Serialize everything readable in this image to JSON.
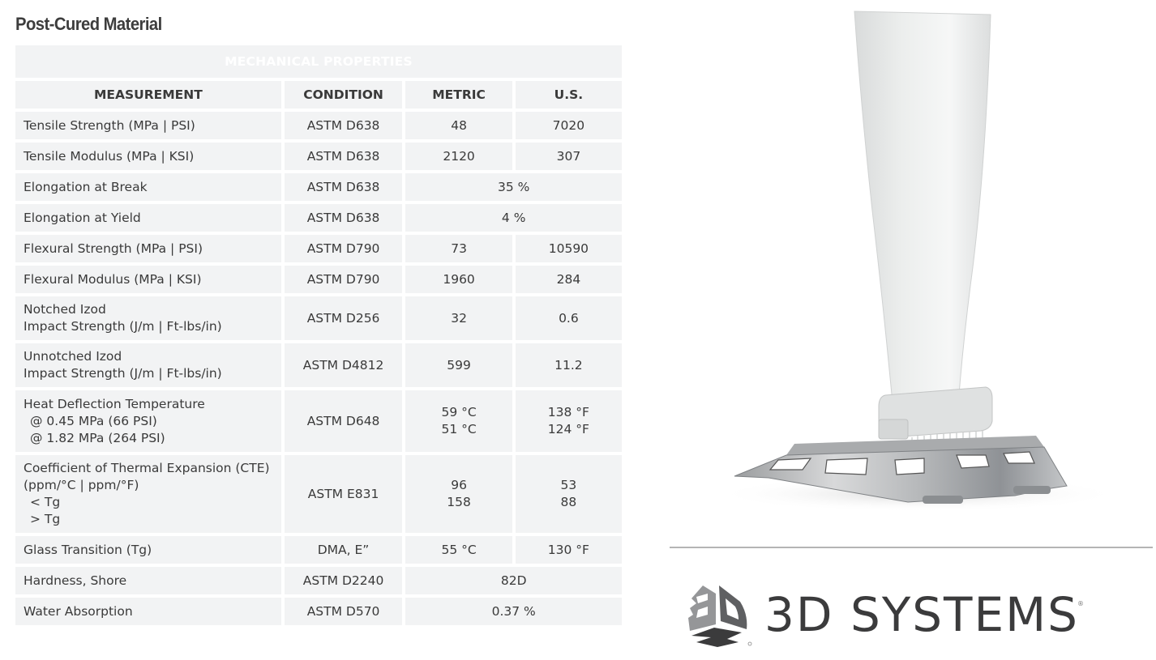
{
  "page": {
    "title": "Post-Cured Material"
  },
  "table": {
    "banner": "MECHANICAL PROPERTIES",
    "headers": {
      "measurement": "MEASUREMENT",
      "condition": "CONDITION",
      "metric": "METRIC",
      "us": "U.S."
    },
    "rows": [
      {
        "measurement": "Tensile Strength (MPa | PSI)",
        "condition": "ASTM D638",
        "metric": "48",
        "us": "7020"
      },
      {
        "measurement": "Tensile Modulus (MPa | KSI)",
        "condition": "ASTM D638",
        "metric": "2120",
        "us": "307"
      },
      {
        "measurement": "Elongation at Break",
        "condition": "ASTM D638",
        "combined": "35 %"
      },
      {
        "measurement": "Elongation at Yield",
        "condition": "ASTM D638",
        "combined": "4 %"
      },
      {
        "measurement": "Flexural Strength (MPa | PSI)",
        "condition": "ASTM D790",
        "metric": "73",
        "us": "10590"
      },
      {
        "measurement": "Flexural Modulus (MPa | KSI)",
        "condition": "ASTM D790",
        "metric": "1960",
        "us": "284"
      },
      {
        "measurement_lines": [
          "Notched Izod",
          "Impact Strength (J/m | Ft-lbs/in)"
        ],
        "condition": "ASTM D256",
        "metric": "32",
        "us": "0.6"
      },
      {
        "measurement_lines": [
          "Unnotched Izod",
          "Impact Strength (J/m | Ft-lbs/in)"
        ],
        "condition": "ASTM D4812",
        "metric": "599",
        "us": "11.2"
      },
      {
        "measurement_lines": [
          "Heat Deflection Temperature",
          "@ 0.45 MPa (66 PSI)",
          "@ 1.82 MPa (264 PSI)"
        ],
        "condition": "ASTM D648",
        "metric_lines": [
          "59 °C",
          "51 °C"
        ],
        "us_lines": [
          "138 °F",
          "124 °F"
        ]
      },
      {
        "measurement_lines": [
          "Coefficient of Thermal Expansion (CTE)",
          "(ppm/°C | ppm/°F)",
          "< Tg",
          "> Tg"
        ],
        "condition": "ASTM E831",
        "metric_lines": [
          "96",
          "158"
        ],
        "us_lines": [
          "53",
          "88"
        ]
      },
      {
        "measurement": "Glass Transition (Tg)",
        "condition": "DMA, E”",
        "metric": "55 °C",
        "us": "130 °F"
      },
      {
        "measurement": "Hardness, Shore",
        "condition": "ASTM D2240",
        "combined": "82D"
      },
      {
        "measurement": "Water Absorption",
        "condition": "ASTM D570",
        "combined": "0.37 %"
      }
    ]
  },
  "product_image": {
    "description": "3D printed white turbine blade on metal build platform"
  },
  "logo": {
    "text": "3D SYSTEMS",
    "registered": "®"
  },
  "colors": {
    "banner_bg": "#97989b",
    "header_bg": "#e2e2e3",
    "cell_bg": "#f2f3f4",
    "text": "#3a3a3a",
    "logo_dark": "#3b3b3c"
  }
}
